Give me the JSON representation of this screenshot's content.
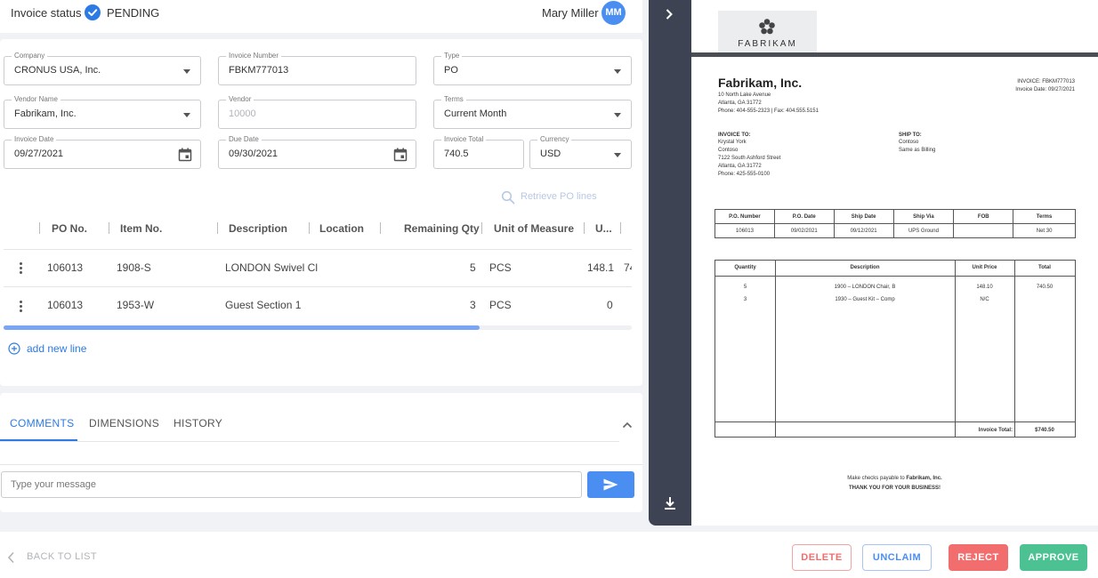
{
  "header": {
    "status_label": "Invoice status",
    "status_value": "PENDING",
    "user_name": "Mary Miller",
    "user_initials": "MM"
  },
  "form": {
    "company": {
      "label": "Company",
      "value": "CRONUS USA, Inc."
    },
    "invoice_number": {
      "label": "Invoice Number",
      "value": "FBKM777013"
    },
    "type": {
      "label": "Type",
      "value": "PO"
    },
    "vendor_name": {
      "label": "Vendor Name",
      "value": "Fabrikam, Inc."
    },
    "vendor": {
      "label": "Vendor",
      "value": "10000"
    },
    "terms": {
      "label": "Terms",
      "value": "Current Month"
    },
    "invoice_date": {
      "label": "Invoice Date",
      "value": "09/27/2021"
    },
    "due_date": {
      "label": "Due Date",
      "value": "09/30/2021"
    },
    "invoice_total": {
      "label": "Invoice Total",
      "value": "740.5"
    },
    "currency": {
      "label": "Currency",
      "value": "USD"
    }
  },
  "retrieve_label": "Retrieve PO lines",
  "lines_table": {
    "columns": [
      "PO No.",
      "Item No.",
      "Description",
      "Location",
      "Remaining Qty",
      "Unit of Measure",
      "U..."
    ],
    "rows": [
      {
        "po": "106013",
        "item": "1908-S",
        "description": "LONDON Swivel Cl",
        "location": "",
        "qty": "5",
        "uom": "PCS",
        "unit": "148.1",
        "extra": "74"
      },
      {
        "po": "106013",
        "item": "1953-W",
        "description": "Guest Section 1",
        "location": "",
        "qty": "3",
        "uom": "PCS",
        "unit": "0",
        "extra": ""
      }
    ]
  },
  "add_line_label": "add new line",
  "comments": {
    "tabs": [
      "COMMENTS",
      "DIMENSIONS",
      "HISTORY"
    ],
    "placeholder": "Type your message"
  },
  "footer": {
    "back_label": "BACK TO LIST",
    "delete_label": "DELETE",
    "unclaim_label": "UNCLAIM",
    "reject_label": "REJECT",
    "approve_label": "APPROVE"
  },
  "document": {
    "logo_text": "FABRIKAM",
    "company_name": "Fabrikam, Inc.",
    "address_lines": [
      "10 North Lake Avenue",
      "Atlanta, GA 31772",
      "Phone: 404-555-2323  |  Fax: 404.555.5151"
    ],
    "invoice_no": "INVOICE: FBKM777013",
    "invoice_date": "Invoice Date: 09/27/2021",
    "invoice_to_title": "INVOICE TO:",
    "invoice_to_lines": [
      "Krystal York",
      "Contoso",
      "7122 South Ashford Street",
      "Atlanta, GA 31772",
      "Phone: 425-555-0100"
    ],
    "ship_to_title": "SHIP TO:",
    "ship_to_lines": [
      "Contoso",
      "Same as Billing"
    ],
    "po_table": {
      "headers": [
        "P.O. Number",
        "P.O. Date",
        "Ship Date",
        "Ship Via",
        "FOB",
        "Terms"
      ],
      "row": [
        "106013",
        "09/02/2021",
        "09/12/2021",
        "UPS Ground",
        "",
        "Net 30"
      ]
    },
    "items_table": {
      "headers": [
        "Quantity",
        "Description",
        "Unit Price",
        "Total"
      ],
      "rows": [
        [
          "5",
          "1900 – LONDON Chair, B",
          "148.10",
          "740.50"
        ],
        [
          "3",
          "1930 – Guest Kit – Comp",
          "N/C",
          ""
        ]
      ],
      "total_label": "Invoice Total:",
      "total_value": "$740.50"
    },
    "payable_text": "Make checks payable to",
    "payable_company": "Fabrikam, Inc.",
    "thanks": "THANK YOU FOR YOUR BUSINESS!"
  },
  "colors": {
    "accent": "#2c7be5",
    "approve": "#4cc192",
    "reject": "#f26d6d",
    "side_strip": "#3e4353"
  }
}
